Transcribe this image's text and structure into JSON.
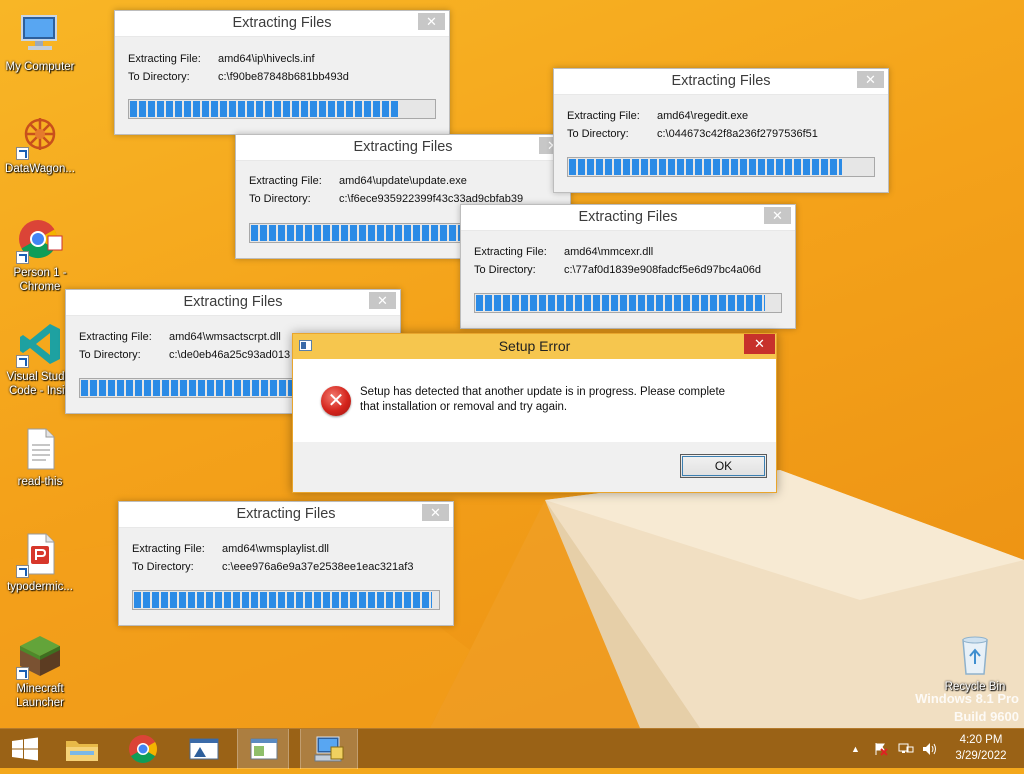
{
  "desktop": {
    "icons": [
      {
        "label": "My Computer"
      },
      {
        "label": "DataWagon..."
      },
      {
        "label": "Person 1 - Chrome"
      },
      {
        "label": "Visual Studio Code - Insid"
      },
      {
        "label": "read-this"
      },
      {
        "label": "typodermic..."
      },
      {
        "label": "Minecraft Launcher"
      },
      {
        "label": "Recycle Bin"
      }
    ],
    "watermark": {
      "line1": "Windows 8.1 Pro",
      "line2": "Build 9600"
    }
  },
  "extract_windows": [
    {
      "title": "Extracting Files",
      "file_label": "Extracting File:",
      "file": "amd64\\ip\\hivecls.inf",
      "dir_label": "To Directory:",
      "dir": "c:\\f90be87848b681bb493d",
      "progress": 0.89,
      "close": "✕"
    },
    {
      "title": "Extracting Files",
      "file_label": "Extracting File:",
      "file": "amd64\\update\\update.exe",
      "dir_label": "To Directory:",
      "dir": "c:\\f6ece935922399f43c33ad9cbfab39",
      "progress": 0.92,
      "close": "✕"
    },
    {
      "title": "Extracting Files",
      "file_label": "Extracting File:",
      "file": "amd64\\regedit.exe",
      "dir_label": "To Directory:",
      "dir": "c:\\044673c42f8a236f2797536f51",
      "progress": 0.9,
      "close": "✕"
    },
    {
      "title": "Extracting Files",
      "file_label": "Extracting File:",
      "file": "amd64\\mmcexr.dll",
      "dir_label": "To Directory:",
      "dir": "c:\\77af0d1839e908fadcf5e6d97bc4a06d",
      "progress": 0.95,
      "close": "✕"
    },
    {
      "title": "Extracting Files",
      "file_label": "Extracting File:",
      "file": "amd64\\wmsactscrpt.dll",
      "dir_label": "To Directory:",
      "dir": "c:\\de0eb46a25c93ad013",
      "progress": 0.93,
      "close": "✕"
    },
    {
      "title": "Extracting Files",
      "file_label": "Extracting File:",
      "file": "amd64\\wmsplaylist.dll",
      "dir_label": "To Directory:",
      "dir": "c:\\eee976a6e9a37e2538ee1eac321af3",
      "progress": 0.98,
      "close": "✕"
    }
  ],
  "error_dialog": {
    "title": "Setup Error",
    "close": "✕",
    "icon": "✕",
    "message_line1": "Setup has detected that another update is in progress.  Please complete",
    "message_line2": "that installation or removal and try again.",
    "ok_label": "OK"
  },
  "taskbar": {
    "clock_time": "4:20 PM",
    "clock_date": "3/29/2022",
    "tray_chevron": "▲"
  },
  "colors": {
    "progress_blue": "#2b8be6",
    "error_title": "#f6c64e",
    "close_red": "#c7312b",
    "taskbar": "#9a6216"
  }
}
